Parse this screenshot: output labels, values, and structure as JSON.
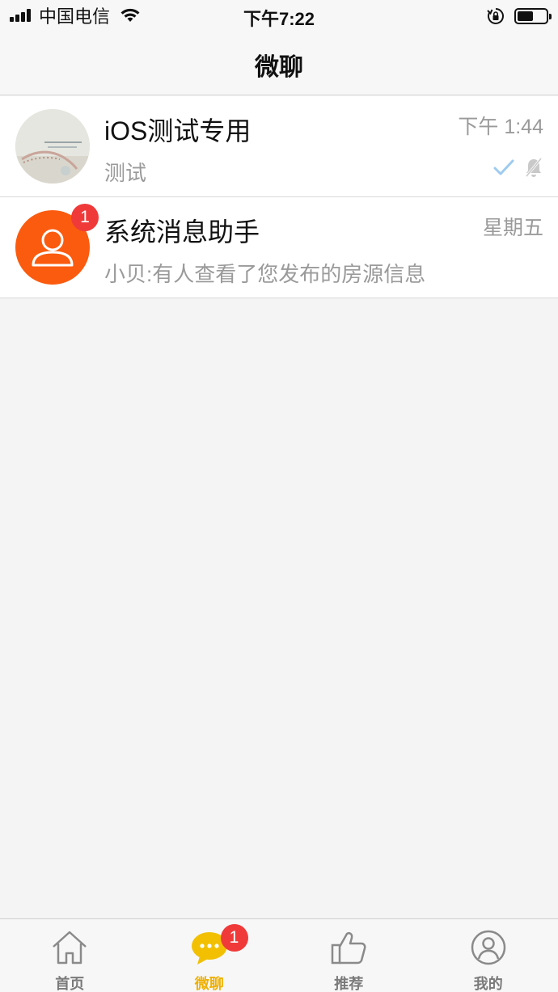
{
  "status_bar": {
    "carrier": "中国电信",
    "time": "下午7:22",
    "battery_level": 0.55
  },
  "nav": {
    "title": "微聊"
  },
  "chats": [
    {
      "name": "iOS测试专用",
      "preview": "测试",
      "time": "下午 1:44",
      "avatar": "photo-avatar",
      "read": true,
      "muted": true
    },
    {
      "name": "系统消息助手",
      "preview": "小贝:有人查看了您发布的房源信息",
      "time": "星期五",
      "avatar": "person-icon",
      "unread": "1"
    }
  ],
  "tabs": [
    {
      "label": "首页",
      "icon": "home-icon",
      "active": false
    },
    {
      "label": "微聊",
      "icon": "chat-bubble-icon",
      "active": true,
      "badge": "1"
    },
    {
      "label": "推荐",
      "icon": "thumbs-up-icon",
      "active": false
    },
    {
      "label": "我的",
      "icon": "profile-icon",
      "active": false
    }
  ],
  "colors": {
    "accent": "#efb100",
    "badge": "#f03a3a",
    "system_avatar": "#fb5b0f",
    "check": "#9ecbf0"
  }
}
